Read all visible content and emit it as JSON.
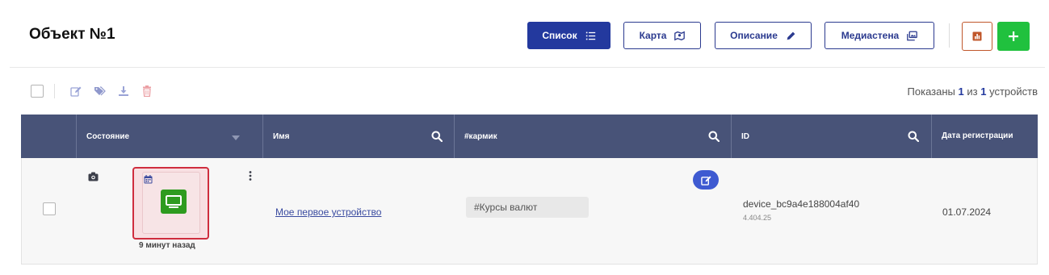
{
  "header": {
    "title": "Объект №1",
    "buttons": {
      "list": "Список",
      "map": "Карта",
      "description": "Описание",
      "mediawall": "Медиастена"
    }
  },
  "toolbar": {
    "shown_prefix": "Показаны",
    "shown_count": "1",
    "shown_mid": "из",
    "shown_total": "1",
    "shown_suffix": "устройств"
  },
  "table": {
    "columns": {
      "state": "Состояние",
      "name": "Имя",
      "tag": "#кармик",
      "id": "ID",
      "reg_date": "Дата регистрации"
    },
    "rows": [
      {
        "time_ago": "9 минут назад",
        "name": "Мое первое устройство",
        "tag": "#Курсы валют",
        "device_id": "device_bc9a4e188004af40",
        "version": "4.404.25",
        "reg_date": "01.07.2024"
      }
    ]
  },
  "colors": {
    "primary": "#23399e",
    "header_bg": "#485378",
    "add": "#20c13e",
    "selected_border": "#cf2d3e",
    "device_online": "#2e9b1f"
  }
}
